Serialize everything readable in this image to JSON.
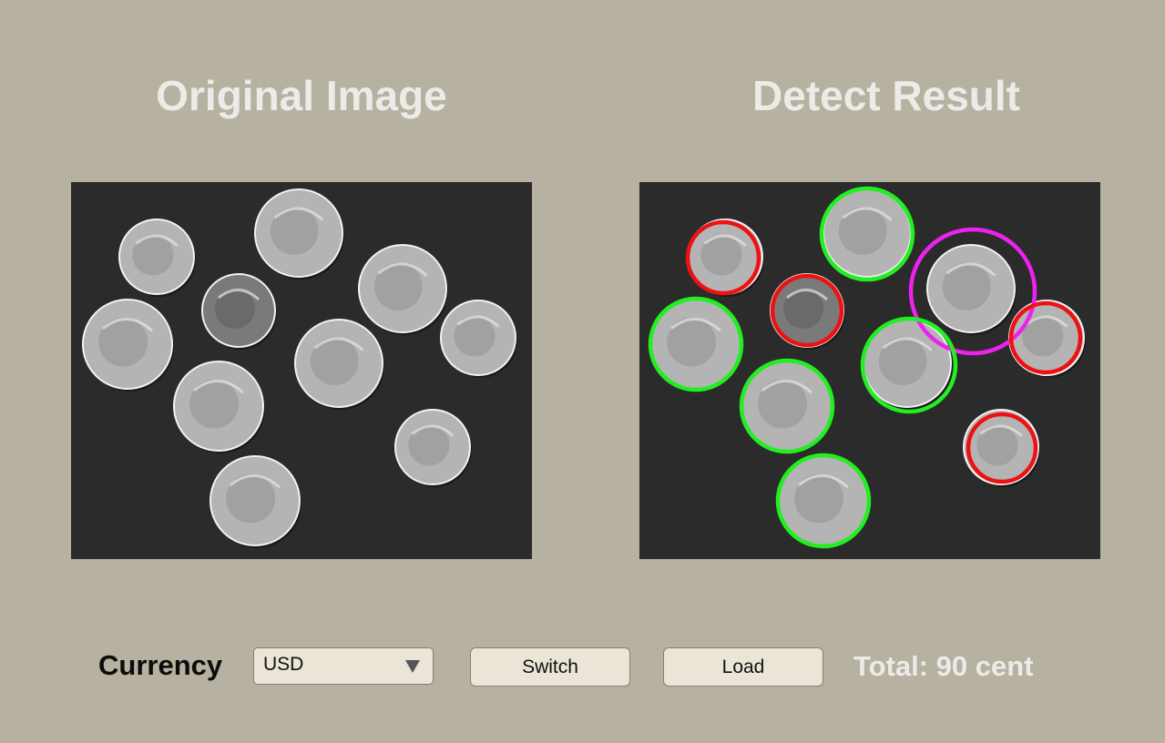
{
  "titles": {
    "original": "Original Image",
    "result": "Detect Result"
  },
  "controls": {
    "currency_label": "Currency",
    "currency_selected": "USD",
    "switch_label": "Switch",
    "load_label": "Load",
    "total_text": "Total: 90 cent"
  },
  "detection_colors": {
    "dime": "#ee1111",
    "nickel": "#22ee22",
    "quarter": "#ee22ee"
  },
  "coin_image_colors": {
    "background": "#2b2b2b",
    "coin_fill": "#b4b4b4",
    "coin_edge": "#f2f2f2",
    "dark_coin_fill": "#7a7a7a"
  }
}
